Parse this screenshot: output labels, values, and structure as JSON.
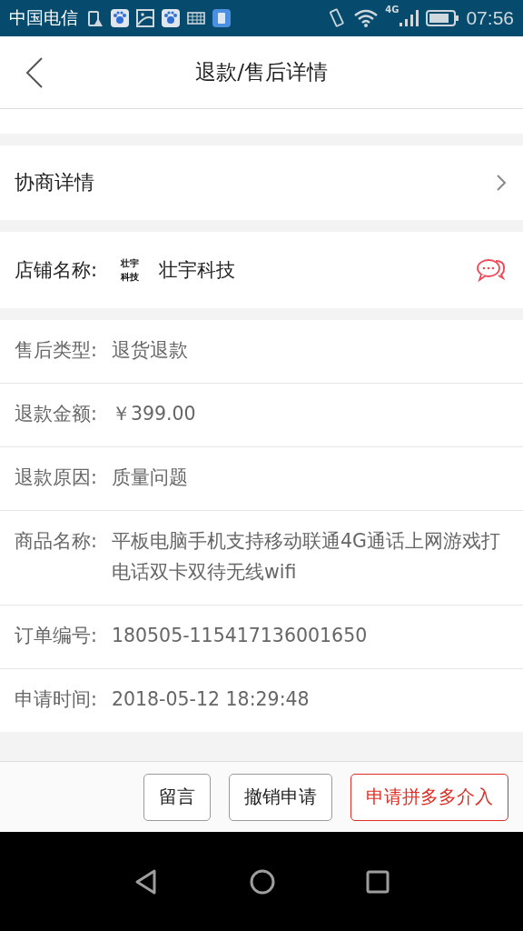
{
  "status_bar": {
    "carrier": "中国电信",
    "network": "4G",
    "time": "07:56"
  },
  "header": {
    "title": "退款/售后详情"
  },
  "negotiation": {
    "label": "协商详情"
  },
  "shop": {
    "label": "店铺名称:",
    "logo_lines": [
      "壮宇",
      "科技"
    ],
    "name": "壮宇科技"
  },
  "details": [
    {
      "label": "售后类型:",
      "value": "退货退款"
    },
    {
      "label": "退款金额:",
      "value": "￥399.00"
    },
    {
      "label": "退款原因:",
      "value": "质量问题"
    },
    {
      "label": "商品名称:",
      "value": "平板电脑手机支持移动联通4G通话上网游戏打电话双卡双待无线wifi"
    },
    {
      "label": "订单编号:",
      "value": "180505-115417136001650"
    },
    {
      "label": "申请时间:",
      "value": "2018-05-12 18:29:48"
    }
  ],
  "actions": [
    {
      "label": "留言",
      "kind": "plain"
    },
    {
      "label": "撤销申请",
      "kind": "plain"
    },
    {
      "label": "申请拼多多介入",
      "kind": "primary"
    }
  ]
}
